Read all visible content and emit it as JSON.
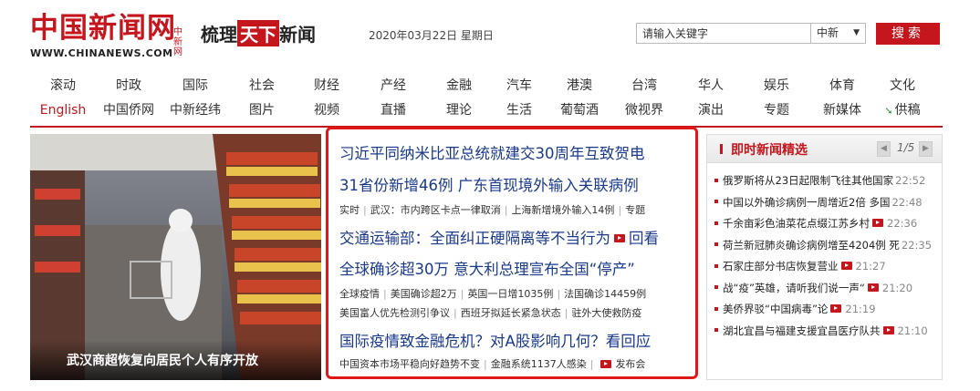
{
  "header": {
    "logo_cn": "中国新闻网",
    "logo_small": "中新网",
    "logo_en": "WWW.CHINANEWS.COM",
    "slogan_pre": "梳理",
    "slogan_box": "天下",
    "slogan_post": "新闻",
    "date": "2020年03月22日  星期日",
    "search_placeholder": "请输入关键字",
    "search_scope": "中新",
    "search_button": "搜索"
  },
  "nav": {
    "row1": [
      "滚动",
      "时政",
      "国际",
      "社会",
      "财经",
      "产经",
      "金融",
      "汽车",
      "港澳",
      "台湾",
      "华人",
      "娱乐",
      "体育",
      "文化"
    ],
    "row2": [
      "English",
      "中国侨网",
      "中新经纬",
      "图片",
      "视频",
      "直播",
      "理论",
      "生活",
      "葡萄酒",
      "微视界",
      "演出",
      "专题",
      "新媒体",
      "供稿"
    ]
  },
  "photo": {
    "caption": "武汉商超恢复向居民个人有序开放"
  },
  "headlines": {
    "h1": "习近平同纳米比亚总统就建交30周年互致贺电",
    "h2": "31省份新增46例 广东首现境外输入关联病例",
    "s1": [
      "实时",
      "武汉：市内跨区卡点一律取消",
      "上海新增境外输入14例",
      "专题"
    ],
    "h3": "交通运输部：全面纠正硬隔离等不当行为",
    "h3_tail": "回看",
    "h4": "全球确诊超30万 意大利总理宣布全国“停产”",
    "s2": [
      "全球疫情",
      "美国确诊超2万",
      "英国一日增1035例",
      "法国确诊14459例"
    ],
    "s3": [
      "美国富人优先检测引争议",
      "西班牙拟延长紧急状态",
      "驻外大使救防疫"
    ],
    "h5": "国际疫情致金融危机？对A股影响几何？看回应",
    "s4": [
      "中国资本市场平稳向好趋势不变",
      "金融系统1137人感染",
      "发布会"
    ]
  },
  "news_panel": {
    "title": "即时新闻精选",
    "page": "1/5",
    "items": [
      {
        "text": "俄罗斯将从23日起限制飞往其他国家",
        "time": "22:52",
        "video": false
      },
      {
        "text": "中国以外确诊病例一周增近2倍 多国",
        "time": "22:48",
        "video": false
      },
      {
        "text": "千余亩彩色油菜花点缀江苏乡村",
        "time": "22:36",
        "video": true
      },
      {
        "text": "荷兰新冠肺炎确诊病例增至4204例 死",
        "time": "22:35",
        "video": false
      },
      {
        "text": "石家庄部分书店恢复营业",
        "time": "21:27",
        "video": true
      },
      {
        "text": "战“疫”英雄，请听我们说一声“",
        "time": "21:20",
        "video": true
      },
      {
        "text": "美侨界驳“中国病毒”论",
        "time": "21:19",
        "video": true
      },
      {
        "text": "湖北宜昌与福建支援宜昌医疗队共",
        "time": "21:10",
        "video": true
      }
    ]
  },
  "colors": {
    "brand_red": "#c4161c",
    "headline_blue": "#1a3a8c",
    "highlight_border": "#e01818"
  }
}
